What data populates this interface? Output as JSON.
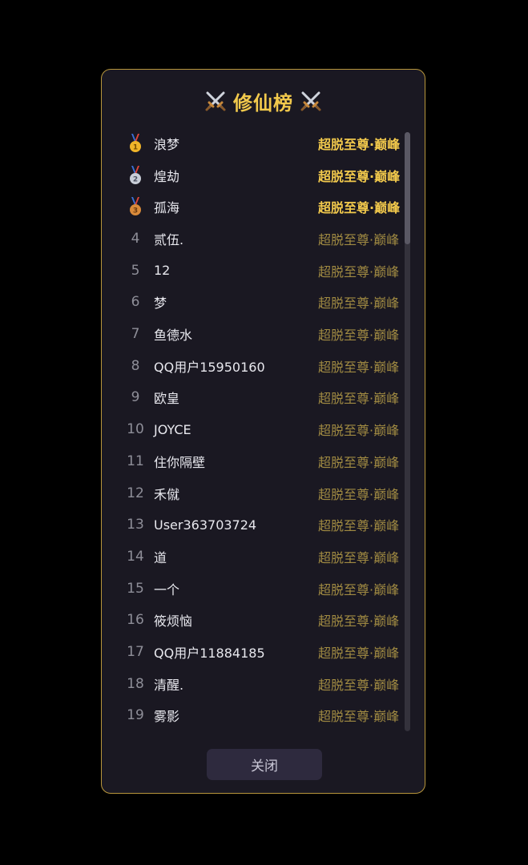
{
  "leaderboard": {
    "title": "修仙榜",
    "title_color": "#f2c94c",
    "border_color": "#b8963c",
    "medal_icons": [
      "gold-medal-icon",
      "silver-medal-icon",
      "bronze-medal-icon"
    ],
    "entries": [
      {
        "rank": "1",
        "name": "浪梦",
        "title": "超脱至尊·巅峰"
      },
      {
        "rank": "2",
        "name": "煌劫",
        "title": "超脱至尊·巅峰"
      },
      {
        "rank": "3",
        "name": "孤海",
        "title": "超脱至尊·巅峰"
      },
      {
        "rank": "4",
        "name": "贰伍.",
        "title": "超脱至尊·巅峰"
      },
      {
        "rank": "5",
        "name": "12",
        "title": "超脱至尊·巅峰"
      },
      {
        "rank": "6",
        "name": "梦",
        "title": "超脱至尊·巅峰"
      },
      {
        "rank": "7",
        "name": "鱼德水",
        "title": "超脱至尊·巅峰"
      },
      {
        "rank": "8",
        "name": "QQ用户15950160",
        "title": "超脱至尊·巅峰"
      },
      {
        "rank": "9",
        "name": "欧皇",
        "title": "超脱至尊·巅峰"
      },
      {
        "rank": "10",
        "name": "JOYCE",
        "title": "超脱至尊·巅峰"
      },
      {
        "rank": "11",
        "name": "住你隔壁",
        "title": "超脱至尊·巅峰"
      },
      {
        "rank": "12",
        "name": "禾僦",
        "title": "超脱至尊·巅峰"
      },
      {
        "rank": "13",
        "name": "User363703724",
        "title": "超脱至尊·巅峰"
      },
      {
        "rank": "14",
        "name": "道",
        "title": "超脱至尊·巅峰"
      },
      {
        "rank": "15",
        "name": "一个",
        "title": "超脱至尊·巅峰"
      },
      {
        "rank": "16",
        "name": "筱烦恼",
        "title": "超脱至尊·巅峰"
      },
      {
        "rank": "17",
        "name": "QQ用户11884185",
        "title": "超脱至尊·巅峰"
      },
      {
        "rank": "18",
        "name": "清醒.",
        "title": "超脱至尊·巅峰"
      },
      {
        "rank": "19",
        "name": "雾影",
        "title": "超脱至尊·巅峰"
      }
    ],
    "close_label": "关闭"
  }
}
